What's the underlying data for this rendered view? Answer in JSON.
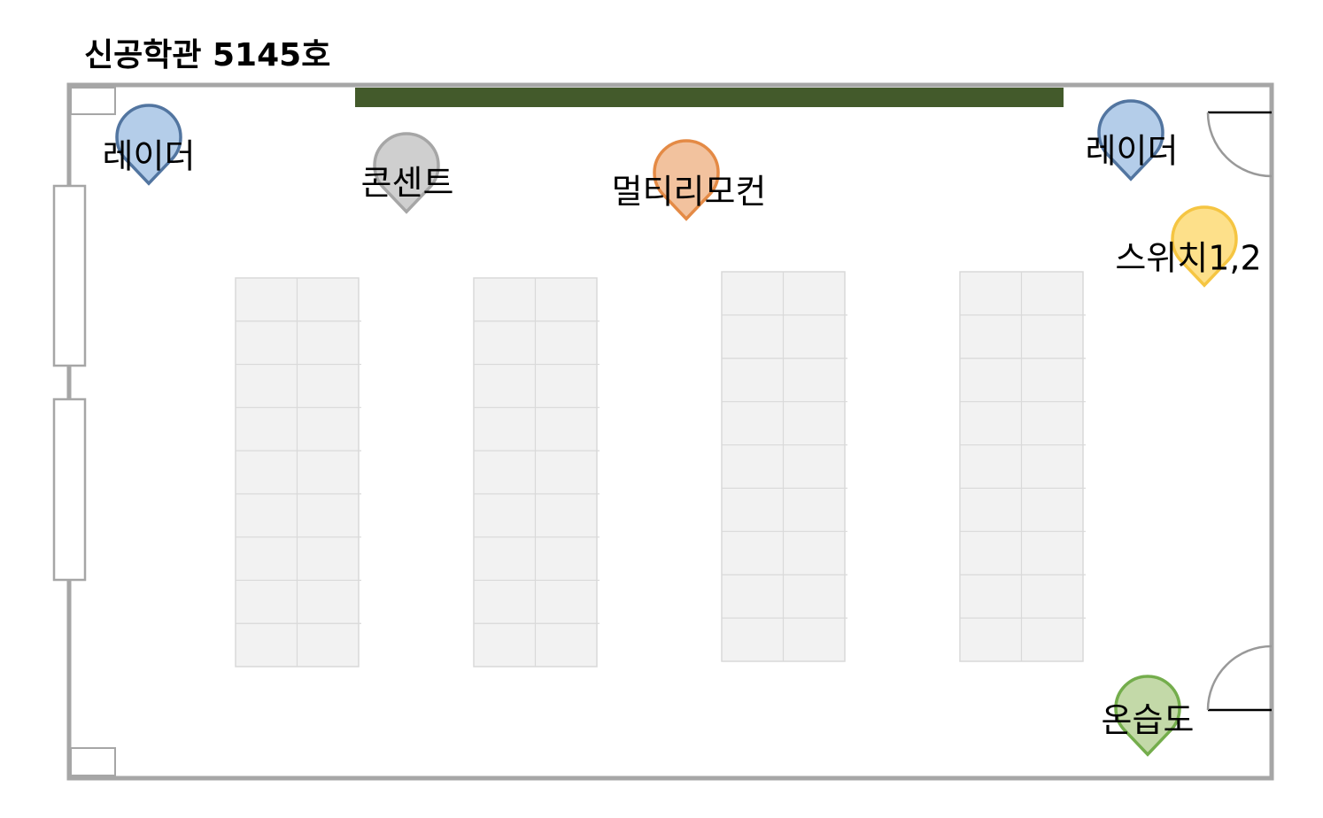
{
  "title": "신공학관 5145호",
  "colors": {
    "wall": "#a6a6a6",
    "board": "#435a2b",
    "desk_fill": "#f2f2f2",
    "desk_line": "#d9d9d9"
  },
  "desks": {
    "count": 4,
    "columns_per_desk": 2,
    "rows_per_desk": 9
  },
  "markers": [
    {
      "id": "radar-left",
      "label": "레이더",
      "icon": "map-pin-icon",
      "fill": "#b4cde9",
      "stroke": "#5275a0"
    },
    {
      "id": "outlet",
      "label": "콘센트",
      "icon": "map-pin-icon",
      "fill": "#cfcfcf",
      "stroke": "#a6a6a6"
    },
    {
      "id": "multi-remote",
      "label": "멀티리모컨",
      "icon": "map-pin-icon",
      "fill": "#f2c29e",
      "stroke": "#e48a45"
    },
    {
      "id": "radar-right",
      "label": "레이더",
      "icon": "map-pin-icon",
      "fill": "#b4cde9",
      "stroke": "#5275a0"
    },
    {
      "id": "switch",
      "label": "스위치1,2",
      "icon": "map-pin-icon",
      "fill": "#fde08a",
      "stroke": "#f5c542"
    },
    {
      "id": "thermo-hygro",
      "label": "온습도",
      "icon": "map-pin-icon",
      "fill": "#c3d9a8",
      "stroke": "#74ad4c"
    }
  ]
}
